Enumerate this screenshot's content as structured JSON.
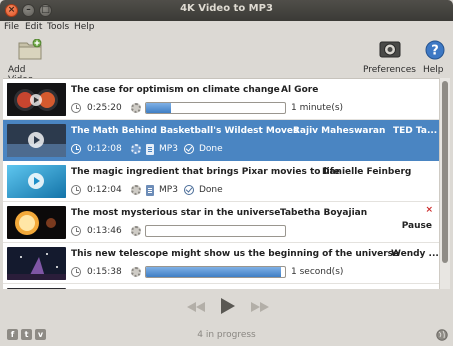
{
  "window": {
    "title": "4K Video to MP3",
    "close_glyph": "×",
    "min_glyph": "–",
    "max_glyph": "□"
  },
  "menu": [
    "File",
    "Edit",
    "Tools",
    "Help"
  ],
  "toolbar": {
    "add_video_label": "Add Video",
    "preferences_label": "Preferences",
    "help_label": "Help"
  },
  "rows": [
    {
      "title": "The case for optimism on climate change",
      "author": "Al Gore",
      "duration": "0:25:20",
      "progress": 0.18,
      "eta": "1 minute(s)",
      "state": "downloading"
    },
    {
      "title": "The Math Behind Basketball's Wildest Moves",
      "author": "Rajiv Maheswaran",
      "extra": "TED Ta...",
      "duration": "0:12:08",
      "format": "MP3",
      "status": "Done",
      "state": "done",
      "selected": true
    },
    {
      "title": "The magic ingredient that brings Pixar movies to life",
      "author": "Danielle Feinberg",
      "duration": "0:12:04",
      "format": "MP3",
      "status": "Done",
      "state": "done"
    },
    {
      "title": "The most mysterious star in the universe",
      "author": "Tabetha Boyajian",
      "duration": "0:13:46",
      "progress": 0.0,
      "action": "Pause",
      "remove_glyph": "×",
      "state": "paused"
    },
    {
      "title": "This new telescope might show us the beginning of the universe",
      "author": "Wendy ...",
      "duration": "0:15:38",
      "progress": 0.97,
      "eta": "1 second(s)",
      "state": "downloading"
    }
  ],
  "footer": {
    "status_text": "4 in progress",
    "social": [
      "f",
      "t",
      "v"
    ]
  },
  "colors": {
    "selection": "#4a85c2",
    "progress_fill": "#3f7fc4",
    "remove": "#cc2a2a"
  }
}
